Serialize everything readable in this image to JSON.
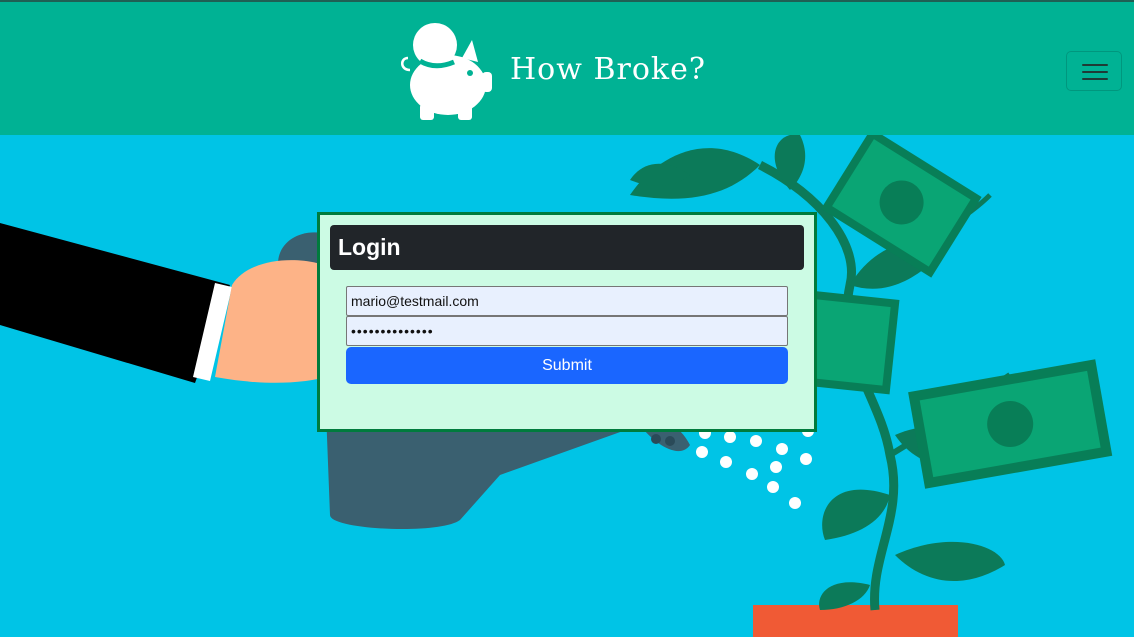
{
  "navbar": {
    "brand_name": "How Broke?",
    "logo_icon": "piggy-bank-icon",
    "menu_icon": "hamburger-menu-icon"
  },
  "login": {
    "title": "Login",
    "email_value": "mario@testmail.com",
    "password_value": "••••••••••••••",
    "submit_label": "Submit"
  },
  "colors": {
    "navbar": "#00b294",
    "background": "#00c4e6",
    "card": "#ccfbe4",
    "card_border": "#007b3d",
    "header": "#212529",
    "button": "#1a66ff"
  }
}
